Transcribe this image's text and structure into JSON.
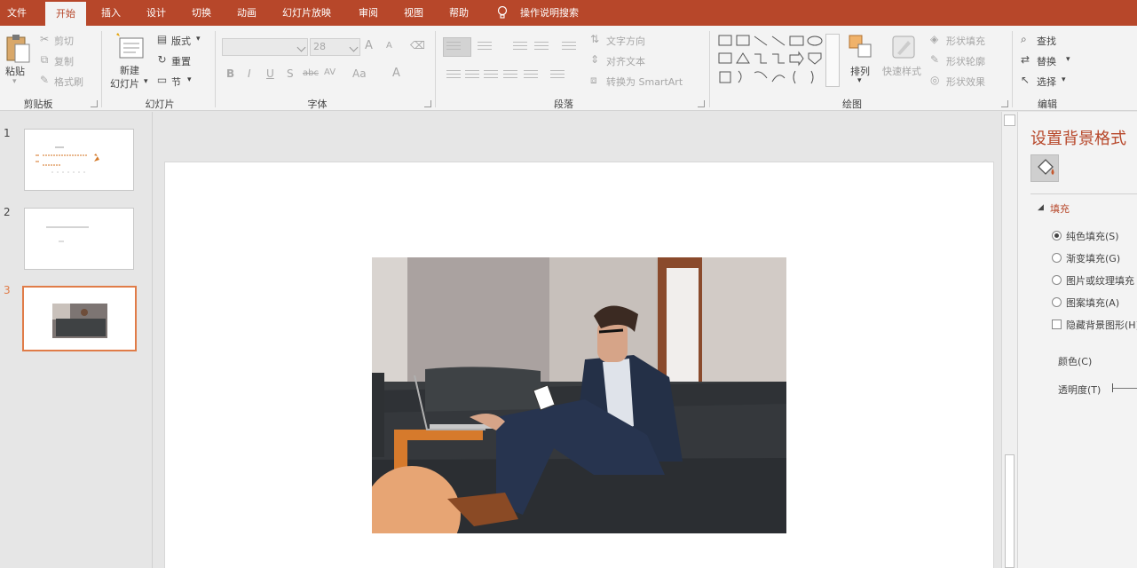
{
  "menu": {
    "tabs": [
      {
        "label": "文件"
      },
      {
        "label": "开始"
      },
      {
        "label": "插入"
      },
      {
        "label": "设计"
      },
      {
        "label": "切换"
      },
      {
        "label": "动画"
      },
      {
        "label": "幻灯片放映"
      },
      {
        "label": "审阅"
      },
      {
        "label": "视图"
      },
      {
        "label": "帮助"
      }
    ],
    "active_tab": "开始",
    "tell_me": "操作说明搜索",
    "accent_color": "#b7472a"
  },
  "ribbon": {
    "clipboard": {
      "label": "剪贴板",
      "paste": "粘贴",
      "cut": "剪切",
      "copy": "复制",
      "format_painter": "格式刷"
    },
    "slides": {
      "label": "幻灯片",
      "new_slide_line1": "新建",
      "new_slide_line2": "幻灯片",
      "layout": "版式",
      "reset": "重置",
      "section": "节"
    },
    "font": {
      "label": "字体",
      "font_size": "28",
      "bold": "B",
      "italic": "I",
      "underline": "U",
      "shadow": "S",
      "strikethrough": "abc",
      "spacing": "AV",
      "change_case": "Aa",
      "grow": "A",
      "shrink": "A",
      "font_color": "A"
    },
    "paragraph": {
      "label": "段落",
      "text_direction": "文字方向",
      "align_text": "对齐文本",
      "convert_smartart": "转换为 SmartArt"
    },
    "drawing": {
      "label": "绘图",
      "arrange": "排列",
      "quick_styles": "快速样式",
      "shape_fill": "形状填充",
      "shape_outline": "形状轮廓",
      "shape_effects": "形状效果"
    },
    "editing": {
      "label": "编辑",
      "find": "查找",
      "replace": "替换",
      "select": "选择"
    }
  },
  "slides_panel": {
    "items": [
      {
        "number": "1"
      },
      {
        "number": "2"
      },
      {
        "number": "3"
      }
    ],
    "selected": "3"
  },
  "format_pane": {
    "title": "设置背景格式",
    "section": "填充",
    "options": [
      {
        "label": "纯色填充(S)",
        "selected": true
      },
      {
        "label": "渐变填充(G)",
        "selected": false
      },
      {
        "label": "图片或纹理填充",
        "selected": false
      },
      {
        "label": "图案填充(A)",
        "selected": false
      }
    ],
    "hide_graphics": "隐藏背景图形(H)",
    "color_label": "颜色(C)",
    "transparency_label": "透明度(T)"
  }
}
